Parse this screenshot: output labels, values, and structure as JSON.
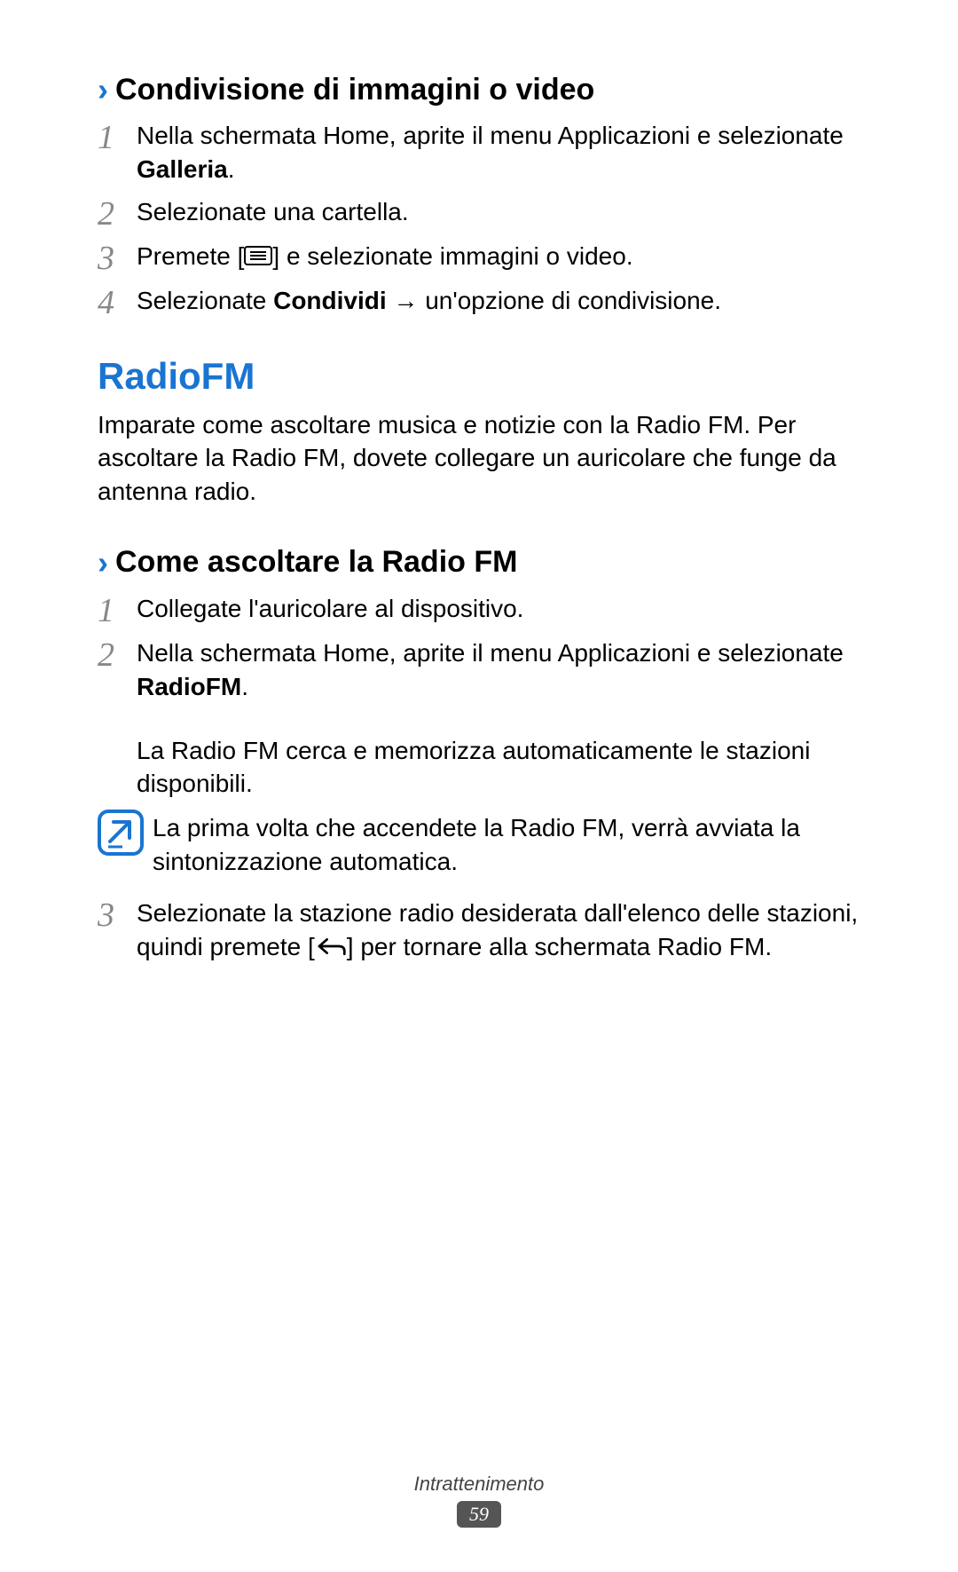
{
  "section1": {
    "heading": "Condivisione di immagini o video",
    "steps": [
      {
        "n": "1",
        "pre": "Nella schermata Home, aprite il menu Applicazioni e selezionate ",
        "bold": "Galleria",
        "post": "."
      },
      {
        "n": "2",
        "text": "Selezionate una cartella."
      },
      {
        "n": "3",
        "pre": "Premete [",
        "icon": "menu",
        "post": "] e selezionate immagini o video."
      },
      {
        "n": "4",
        "pre": "Selezionate ",
        "bold": "Condividi",
        "post2": " → un'opzione di condivisione."
      }
    ]
  },
  "mainTitle": "RadioFM",
  "intro": "Imparate come ascoltare musica e notizie con la Radio FM. Per ascoltare la Radio FM, dovete collegare un auricolare che funge da antenna radio.",
  "section2": {
    "heading": "Come ascoltare la Radio FM",
    "step1": {
      "n": "1",
      "text": "Collegate l'auricolare al dispositivo."
    },
    "step2": {
      "n": "2",
      "pre": "Nella schermata Home, aprite il menu Applicazioni e selezionate ",
      "bold": "RadioFM",
      "post": "."
    },
    "sub2": "La Radio FM cerca e memorizza automaticamente le stazioni disponibili.",
    "note": "La prima volta che accendete la Radio FM, verrà avviata la sintonizzazione automatica.",
    "step3": {
      "n": "3",
      "pre": "Selezionate la stazione radio desiderata dall'elenco delle stazioni, quindi premete [",
      "icon": "back",
      "post": "] per tornare alla schermata Radio FM."
    }
  },
  "footer": {
    "category": "Intrattenimento",
    "page": "59"
  }
}
